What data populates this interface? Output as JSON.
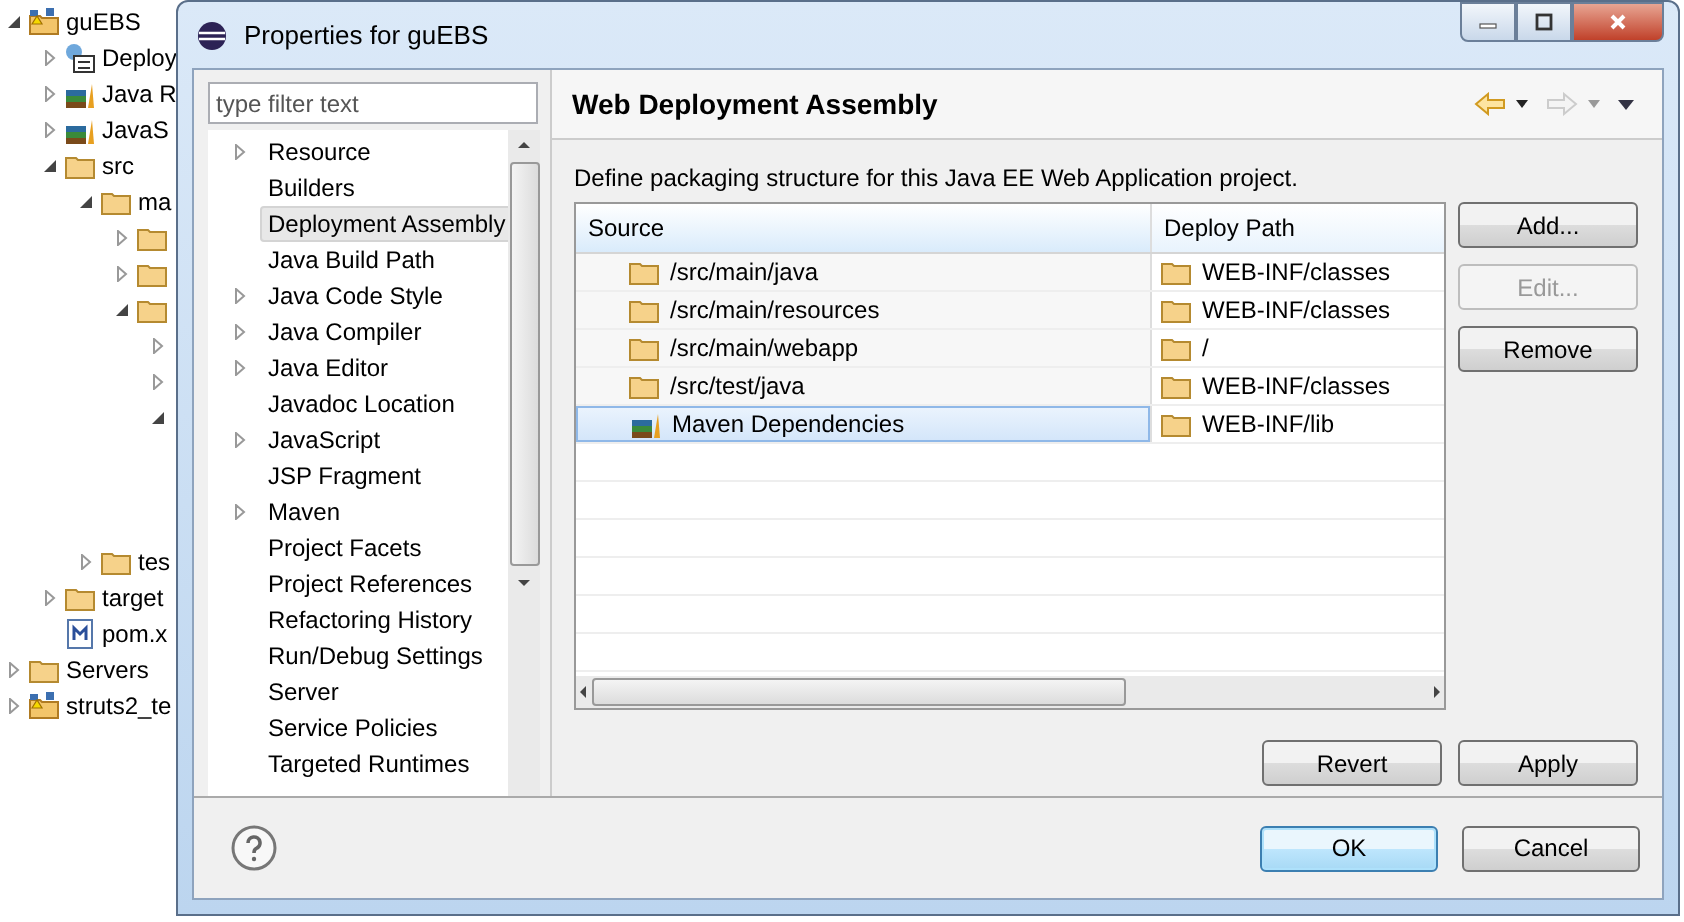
{
  "explorer": {
    "tree": [
      {
        "label": "guEBS",
        "kind": "project",
        "expanded": true,
        "children": [
          {
            "label": "Deploy",
            "kind": "descriptor",
            "expanded": false
          },
          {
            "label": "Java R",
            "kind": "library",
            "expanded": false
          },
          {
            "label": "JavaS",
            "kind": "library",
            "expanded": false
          },
          {
            "label": "src",
            "kind": "folder",
            "expanded": true,
            "children": [
              {
                "label": "ma",
                "kind": "folder",
                "expanded": true,
                "children": [
                  {
                    "kind": "folder",
                    "expanded": false
                  },
                  {
                    "kind": "folder",
                    "expanded": false
                  },
                  {
                    "kind": "folder",
                    "expanded": true,
                    "children": [
                      {
                        "expanded": false
                      },
                      {
                        "expanded": false
                      },
                      {
                        "expanded": true
                      }
                    ]
                  }
                ]
              },
              {
                "label": "tes",
                "kind": "folder",
                "expanded": false
              }
            ]
          },
          {
            "label": "target",
            "kind": "folder",
            "expanded": false
          },
          {
            "label": "pom.x",
            "kind": "file"
          }
        ]
      },
      {
        "label": "Servers",
        "kind": "folder",
        "expanded": false
      },
      {
        "label": "struts2_te",
        "kind": "project",
        "expanded": false
      }
    ]
  },
  "dialog": {
    "title": "Properties for guEBS",
    "filter": {
      "placeholder": "type filter text"
    },
    "pages": [
      {
        "label": "Resource",
        "expanded": false,
        "selected": false
      },
      {
        "label": "Builders",
        "selected": false
      },
      {
        "label": "Deployment Assembly",
        "selected": true
      },
      {
        "label": "Java Build Path",
        "selected": false
      },
      {
        "label": "Java Code Style",
        "expanded": false,
        "selected": false
      },
      {
        "label": "Java Compiler",
        "expanded": false,
        "selected": false
      },
      {
        "label": "Java Editor",
        "expanded": false,
        "selected": false
      },
      {
        "label": "Javadoc Location",
        "selected": false
      },
      {
        "label": "JavaScript",
        "expanded": false,
        "selected": false
      },
      {
        "label": "JSP Fragment",
        "selected": false
      },
      {
        "label": "Maven",
        "expanded": false,
        "selected": false
      },
      {
        "label": "Project Facets",
        "selected": false
      },
      {
        "label": "Project References",
        "selected": false
      },
      {
        "label": "Refactoring History",
        "selected": false
      },
      {
        "label": "Run/Debug Settings",
        "selected": false
      },
      {
        "label": "Server",
        "selected": false
      },
      {
        "label": "Service Policies",
        "selected": false
      },
      {
        "label": "Targeted Runtimes",
        "selected": false
      }
    ],
    "page_title": "Web Deployment Assembly",
    "description": "Define packaging structure for this Java EE Web Application project.",
    "table": {
      "columns": [
        "Source",
        "Deploy Path"
      ],
      "rows": [
        {
          "source": "/src/main/java",
          "kind": "folder",
          "deploy_path": "WEB-INF/classes",
          "selected": false
        },
        {
          "source": "/src/main/resources",
          "kind": "folder",
          "deploy_path": "WEB-INF/classes",
          "selected": false
        },
        {
          "source": "/src/main/webapp",
          "kind": "folder",
          "deploy_path": "/",
          "selected": false
        },
        {
          "source": "/src/test/java",
          "kind": "folder",
          "deploy_path": "WEB-INF/classes",
          "selected": false
        },
        {
          "source": "Maven Dependencies",
          "kind": "library",
          "deploy_path": "WEB-INF/lib",
          "selected": true
        }
      ]
    },
    "side_buttons": [
      {
        "label": "Add...",
        "disabled": false
      },
      {
        "label": "Edit...",
        "disabled": true
      },
      {
        "label": "Remove",
        "disabled": false
      }
    ],
    "page_buttons": [
      "Revert",
      "Apply"
    ],
    "footer_buttons": [
      {
        "label": "OK",
        "default": true
      },
      {
        "label": "Cancel",
        "default": false
      }
    ]
  }
}
